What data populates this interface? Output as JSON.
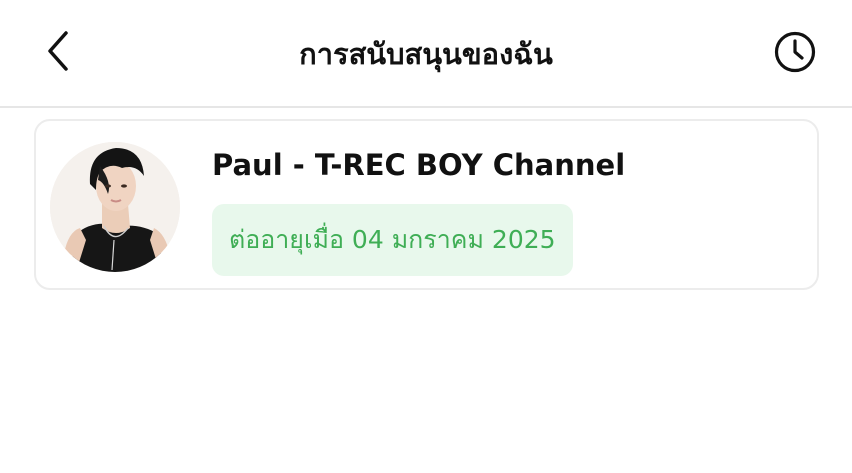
{
  "header": {
    "title": "การสนับสนุนของฉัน",
    "back_icon": "chevron-left-icon",
    "history_icon": "clock-icon"
  },
  "subscription": {
    "channel_name": "Paul - T-REC BOY Channel",
    "renewal_text": "ต่ออายุเมื่อ 04 มกราคม 2025",
    "avatar_icon": "avatar"
  },
  "colors": {
    "accent_green": "#3fae55",
    "badge_background": "#e8f8ec",
    "divider": "#e6e6e6",
    "card_border": "#ececec",
    "text": "#111111"
  }
}
